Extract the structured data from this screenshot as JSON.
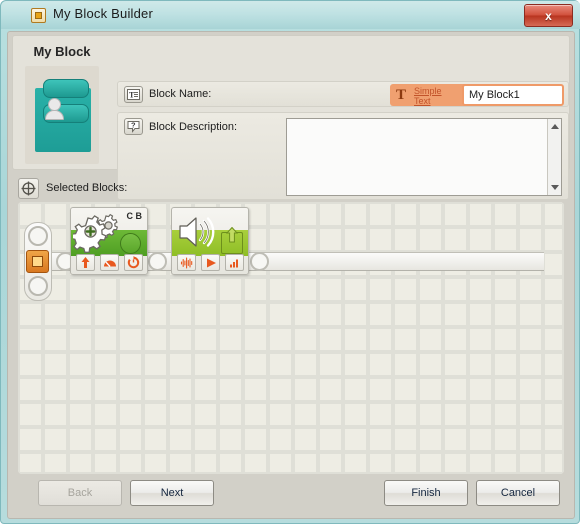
{
  "window": {
    "title": "My Block Builder",
    "title_icon": "myblock-icon",
    "close_label": "x",
    "accent_teal": "#29b1a8",
    "accent_orange": "#f0a070",
    "chrome_color": "#b9e0e0"
  },
  "left_panel": {
    "heading": "My Block",
    "icon_name": "my-block-preview-icon"
  },
  "fields": {
    "block_name": {
      "label": "Block Name:",
      "icon": "text-label-icon",
      "format_chip": {
        "icon": "serif-t-icon",
        "line1": "Simple",
        "line2": "Text"
      },
      "value": "My Block1",
      "placeholder": ""
    },
    "block_description": {
      "label": "Block Description:",
      "icon": "help-bubble-icon",
      "value": "",
      "placeholder": "",
      "scrollbar": {
        "up_icon": "triangle-up-icon",
        "down_icon": "triangle-down-icon"
      }
    }
  },
  "selected_blocks": {
    "label": "Selected Blocks:",
    "icon": "crosshair-target-icon",
    "start_icon": "my-block-start-icon",
    "blocks": [
      {
        "name": "move-block",
        "type": "Move",
        "band_color": "#5aab2c",
        "port_label": "C B",
        "main_icon": "gears-icon",
        "parameter_icons": [
          "up-arrow-icon",
          "speedometer-icon",
          "rotation-icon"
        ]
      },
      {
        "name": "sound-block",
        "type": "Sound",
        "band_color": "#9ac72f",
        "port_label": "",
        "main_icon": "speaker-icon",
        "parameter_icons": [
          "waveform-icon",
          "play-icon",
          "volume-bars-icon"
        ]
      }
    ]
  },
  "footer": {
    "buttons": [
      {
        "name": "back-button",
        "label": "Back",
        "enabled": false
      },
      {
        "name": "next-button",
        "label": "Next",
        "enabled": true
      },
      {
        "name": "finish-button",
        "label": "Finish",
        "enabled": true
      },
      {
        "name": "cancel-button",
        "label": "Cancel",
        "enabled": true
      }
    ]
  }
}
